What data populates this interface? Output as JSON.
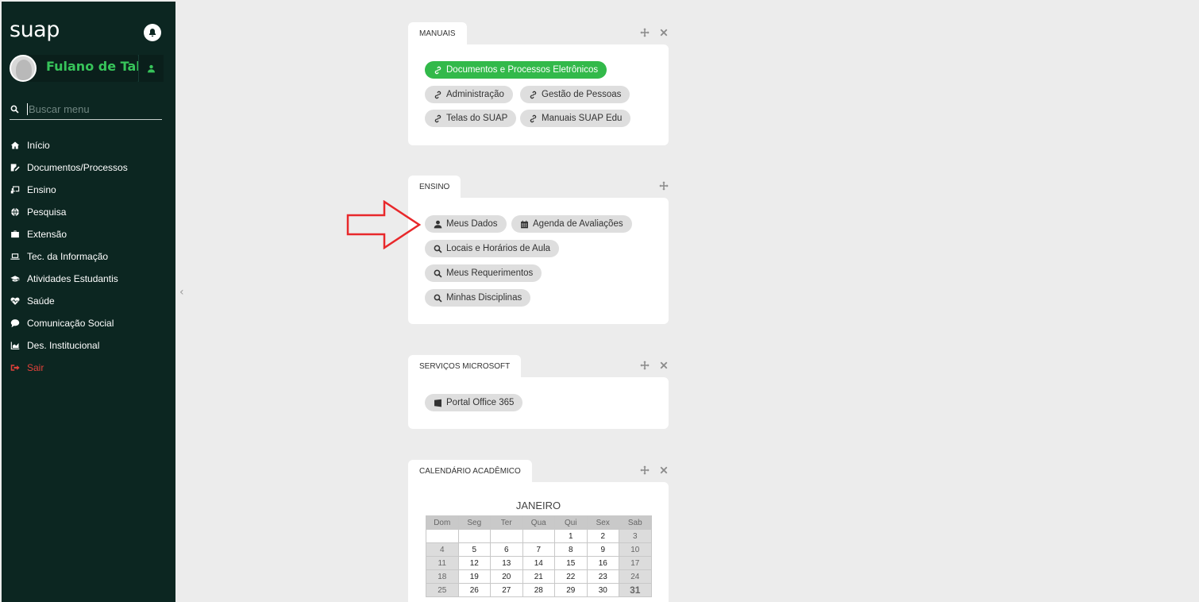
{
  "sidebar": {
    "brand": "suap",
    "user_name": "Fulano de Tal",
    "search_placeholder": "Buscar menu",
    "menu": [
      {
        "label": "Início",
        "icon": "home-icon"
      },
      {
        "label": "Documentos/Processos",
        "icon": "document-edit-icon"
      },
      {
        "label": "Ensino",
        "icon": "chalkboard-icon"
      },
      {
        "label": "Pesquisa",
        "icon": "globe-icon"
      },
      {
        "label": "Extensão",
        "icon": "briefcase-icon"
      },
      {
        "label": "Tec. da Informação",
        "icon": "laptop-icon"
      },
      {
        "label": "Atividades Estudantis",
        "icon": "graduation-cap-icon"
      },
      {
        "label": "Saúde",
        "icon": "heartbeat-icon"
      },
      {
        "label": "Comunicação Social",
        "icon": "comment-icon"
      },
      {
        "label": "Des. Institucional",
        "icon": "chart-area-icon"
      },
      {
        "label": "Sair",
        "icon": "sign-out-icon"
      }
    ]
  },
  "panels": {
    "manuais": {
      "title": "MANUAIS",
      "links": [
        "Documentos e Processos Eletrônicos",
        "Administração",
        "Gestão de Pessoas",
        "Telas do SUAP",
        "Manuais SUAP Edu"
      ]
    },
    "ensino": {
      "title": "ENSINO",
      "links": [
        "Meus Dados",
        "Agenda de Avaliações",
        "Locais e Horários de Aula",
        "Meus Requerimentos",
        "Minhas Disciplinas"
      ]
    },
    "microsoft": {
      "title": "SERVIÇOS MICROSOFT",
      "links": [
        "Portal Office 365"
      ]
    },
    "calendario": {
      "title": "CALENDÁRIO ACADÊMICO",
      "month": "JANEIRO",
      "weekdays": [
        "Dom",
        "Seg",
        "Ter",
        "Qua",
        "Qui",
        "Sex",
        "Sab"
      ],
      "weeks": [
        [
          "",
          "",
          "",
          "",
          "1",
          "2",
          "3"
        ],
        [
          "4",
          "5",
          "6",
          "7",
          "8",
          "9",
          "10"
        ],
        [
          "11",
          "12",
          "13",
          "14",
          "15",
          "16",
          "17"
        ],
        [
          "18",
          "19",
          "20",
          "21",
          "22",
          "23",
          "24"
        ],
        [
          "25",
          "26",
          "27",
          "28",
          "29",
          "30",
          "31"
        ]
      ]
    }
  },
  "colors": {
    "sidebar_bg": "#0c2621",
    "accent_green": "#32b94a",
    "danger": "#e0413a",
    "annotation_arrow": "#e8282b"
  }
}
